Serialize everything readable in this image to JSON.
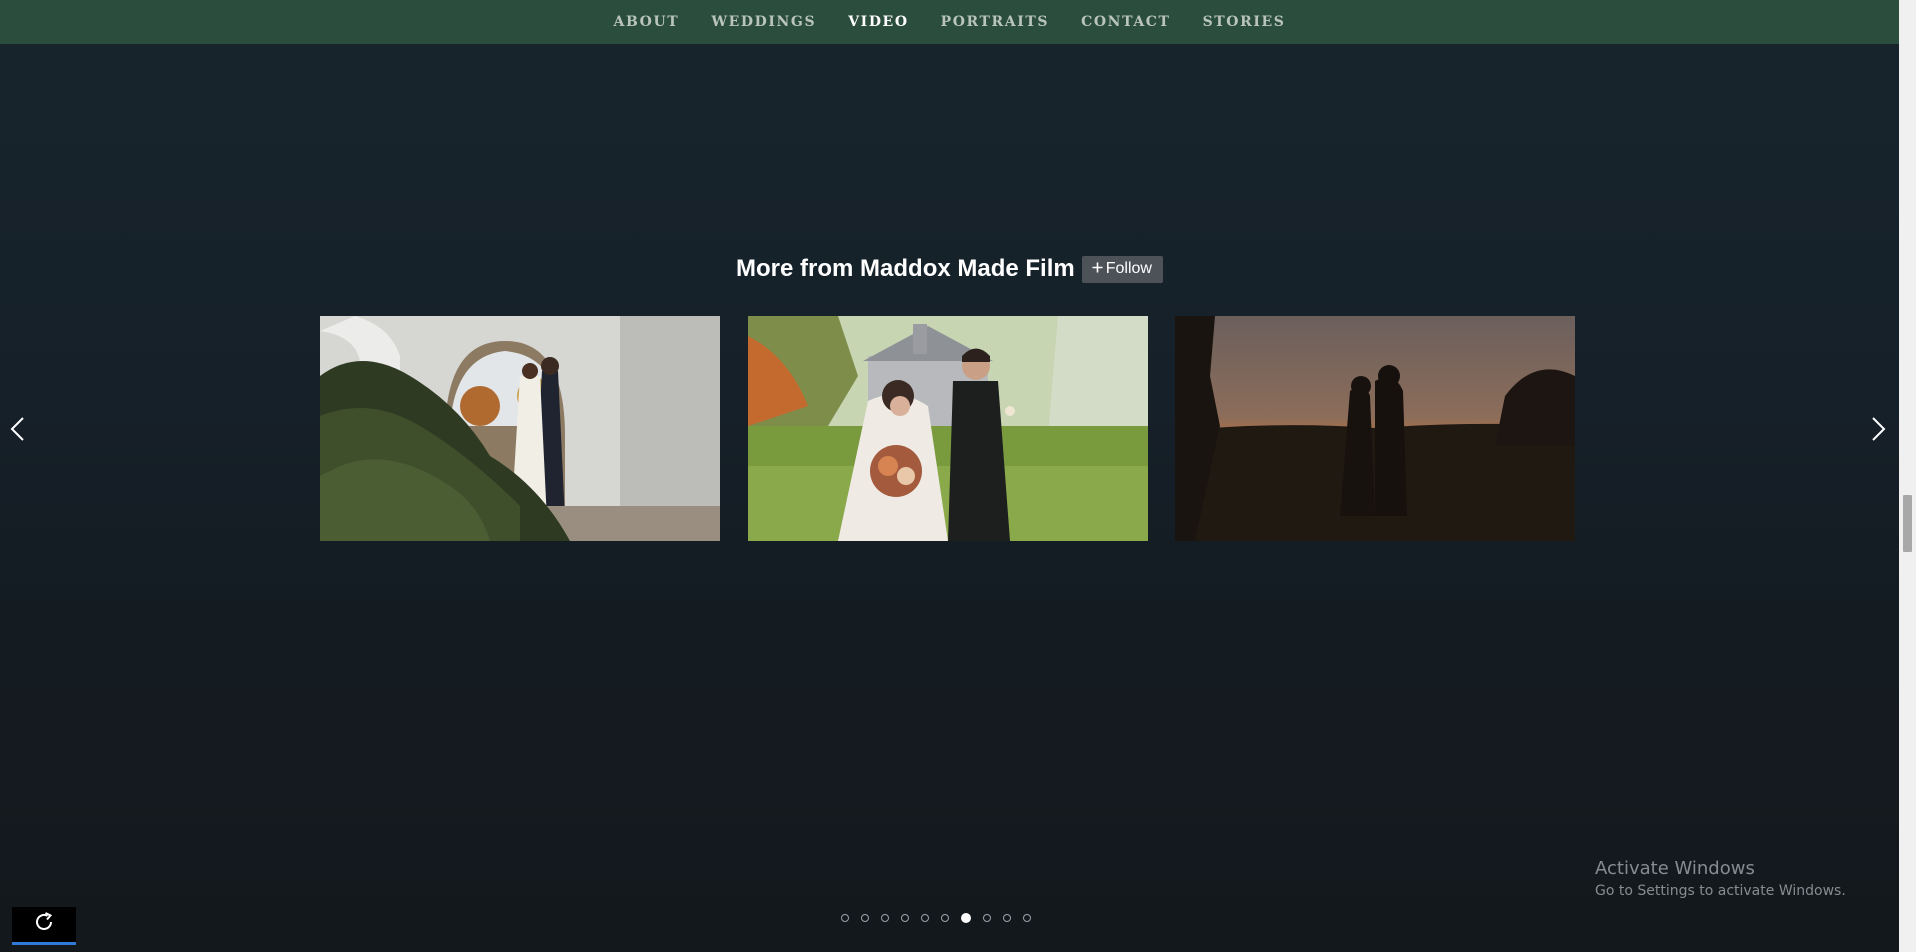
{
  "nav": {
    "items": [
      {
        "label": "ABOUT"
      },
      {
        "label": "WEDDINGS"
      },
      {
        "label": "VIDEO"
      },
      {
        "label": "PORTRAITS"
      },
      {
        "label": "CONTACT"
      },
      {
        "label": "STORIES"
      }
    ],
    "active": "VIDEO"
  },
  "more": {
    "title": "More from Maddox Made Film",
    "follow_label": "Follow",
    "follow_icon": "plus-icon"
  },
  "carousel": {
    "prev_icon": "chevron-left-icon",
    "next_icon": "chevron-right-icon",
    "videos": [
      {
        "description_icon": "couple-archway-thumbnail"
      },
      {
        "description_icon": "couple-chapel-field-thumbnail"
      },
      {
        "description_icon": "couple-sunset-silhouette-thumbnail"
      }
    ]
  },
  "pager": {
    "count": 10,
    "active_index": 6
  },
  "reload": {
    "icon": "reload-icon"
  },
  "watermark": {
    "title": "Activate Windows",
    "subtitle": "Go to Settings to activate Windows."
  },
  "colors": {
    "nav_bg": "#2b4d3e",
    "page_bg": "#151c22",
    "follow_bg": "#4c5257",
    "reload_accent": "#2f7ad6"
  }
}
